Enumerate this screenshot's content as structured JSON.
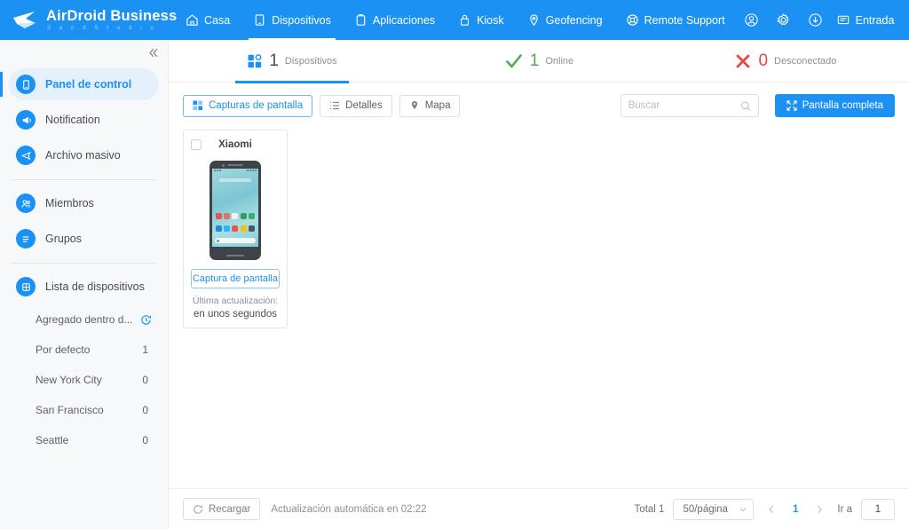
{
  "brand": {
    "title": "AirDroid Business",
    "subtitle": "S a n d   S t u d i o",
    "accent": "#1b91f3"
  },
  "topnav": {
    "items": [
      {
        "label": "Casa",
        "icon": "home-icon",
        "active": false
      },
      {
        "label": "Dispositivos",
        "icon": "device-icon",
        "active": true
      },
      {
        "label": "Aplicaciones",
        "icon": "apps-clipboard-icon",
        "active": false
      },
      {
        "label": "Kiosk",
        "icon": "lock-icon",
        "active": false
      },
      {
        "label": "Geofencing",
        "icon": "location-pin-icon",
        "active": false
      },
      {
        "label": "Remote Support",
        "icon": "lifebuoy-icon",
        "active": false
      }
    ],
    "right": {
      "account_icon": "person-circle-icon",
      "settings_icon": "gear-icon",
      "download_icon": "download-icon",
      "inbox_icon": "message-icon",
      "inbox_label": "Entrada",
      "avatar_icon": "avatar",
      "avatar_caret": "chevron-down-icon"
    }
  },
  "sidebar": {
    "collapse_icon": "double-chevron-left-icon",
    "items": [
      {
        "label": "Panel de control",
        "icon": "dashboard-device-icon",
        "active": true
      },
      {
        "label": "Notification",
        "icon": "megaphone-icon",
        "active": false
      },
      {
        "label": "Archivo masivo",
        "icon": "send-file-icon",
        "active": false
      },
      {
        "label": "Miembros",
        "icon": "members-icon",
        "active": false
      },
      {
        "label": "Grupos",
        "icon": "groups-list-icon",
        "active": false
      },
      {
        "label": "Lista de dispositivos",
        "icon": "device-list-grid-icon",
        "active": false
      }
    ],
    "groups": [
      {
        "label": "Agregado dentro d...",
        "count": "",
        "icon": "history-clock-icon"
      },
      {
        "label": "Por defecto",
        "count": "1",
        "icon": ""
      },
      {
        "label": "New York City",
        "count": "0",
        "icon": ""
      },
      {
        "label": "San Francisco",
        "count": "0",
        "icon": ""
      },
      {
        "label": "Seattle",
        "count": "0",
        "icon": ""
      }
    ]
  },
  "stats": [
    {
      "count": "1",
      "label": "Dispositivos",
      "icon": "devices-blue-icon",
      "state": "total",
      "active": true
    },
    {
      "count": "1",
      "label": "Online",
      "icon": "check-green-icon",
      "state": "online",
      "active": false
    },
    {
      "count": "0",
      "label": "Desconectado",
      "icon": "cross-red-icon",
      "state": "offline",
      "active": false
    }
  ],
  "toolbar": {
    "views": [
      {
        "label": "Capturas de pantalla",
        "icon": "grid-icon",
        "active": true
      },
      {
        "label": "Detalles",
        "icon": "list-icon",
        "active": false
      },
      {
        "label": "Mapa",
        "icon": "map-pin-icon",
        "active": false
      }
    ],
    "search_placeholder": "Buscar",
    "search_value": "",
    "search_icon": "search-icon",
    "fullscreen_label": "Pantalla completa",
    "fullscreen_icon": "expand-icon"
  },
  "devices": [
    {
      "name": "Xiaomi",
      "capture_label": "Captura de pantalla",
      "update_label": "Última actualización:",
      "update_value": "en unos segundos",
      "checked": false
    }
  ],
  "footer": {
    "reload_label": "Recargar",
    "reload_icon": "refresh-icon",
    "auto_update": "Actualización automática en 02:22",
    "total_label": "Total 1",
    "page_size": "50/página",
    "page_size_caret": "chevron-down-icon",
    "prev_icon": "chevron-left-icon",
    "next_icon": "chevron-right-icon",
    "current_page": "1",
    "goto_label": "Ir a",
    "goto_value": "1"
  }
}
